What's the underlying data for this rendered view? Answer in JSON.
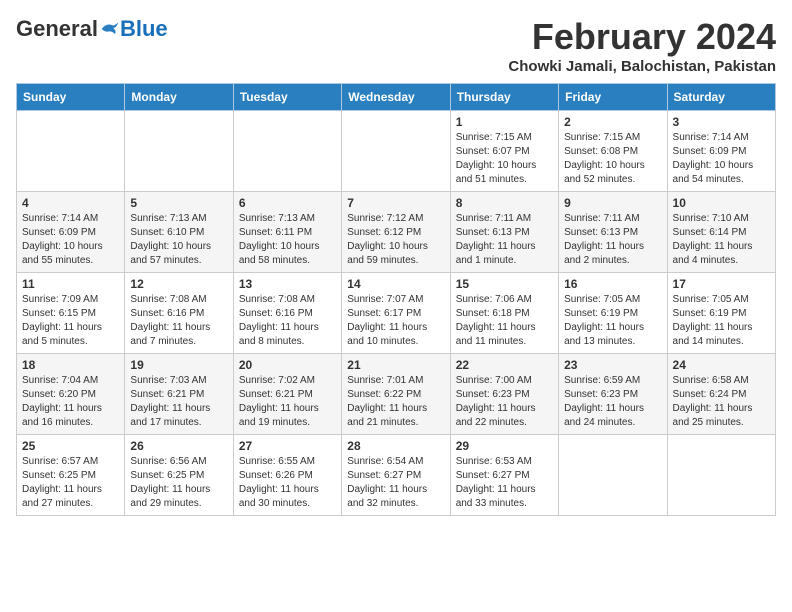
{
  "logo": {
    "general": "General",
    "blue": "Blue"
  },
  "title": "February 2024",
  "location": "Chowki Jamali, Balochistan, Pakistan",
  "days_of_week": [
    "Sunday",
    "Monday",
    "Tuesday",
    "Wednesday",
    "Thursday",
    "Friday",
    "Saturday"
  ],
  "weeks": [
    [
      {
        "day": "",
        "info": ""
      },
      {
        "day": "",
        "info": ""
      },
      {
        "day": "",
        "info": ""
      },
      {
        "day": "",
        "info": ""
      },
      {
        "day": "1",
        "info": "Sunrise: 7:15 AM\nSunset: 6:07 PM\nDaylight: 10 hours\nand 51 minutes."
      },
      {
        "day": "2",
        "info": "Sunrise: 7:15 AM\nSunset: 6:08 PM\nDaylight: 10 hours\nand 52 minutes."
      },
      {
        "day": "3",
        "info": "Sunrise: 7:14 AM\nSunset: 6:09 PM\nDaylight: 10 hours\nand 54 minutes."
      }
    ],
    [
      {
        "day": "4",
        "info": "Sunrise: 7:14 AM\nSunset: 6:09 PM\nDaylight: 10 hours\nand 55 minutes."
      },
      {
        "day": "5",
        "info": "Sunrise: 7:13 AM\nSunset: 6:10 PM\nDaylight: 10 hours\nand 57 minutes."
      },
      {
        "day": "6",
        "info": "Sunrise: 7:13 AM\nSunset: 6:11 PM\nDaylight: 10 hours\nand 58 minutes."
      },
      {
        "day": "7",
        "info": "Sunrise: 7:12 AM\nSunset: 6:12 PM\nDaylight: 10 hours\nand 59 minutes."
      },
      {
        "day": "8",
        "info": "Sunrise: 7:11 AM\nSunset: 6:13 PM\nDaylight: 11 hours\nand 1 minute."
      },
      {
        "day": "9",
        "info": "Sunrise: 7:11 AM\nSunset: 6:13 PM\nDaylight: 11 hours\nand 2 minutes."
      },
      {
        "day": "10",
        "info": "Sunrise: 7:10 AM\nSunset: 6:14 PM\nDaylight: 11 hours\nand 4 minutes."
      }
    ],
    [
      {
        "day": "11",
        "info": "Sunrise: 7:09 AM\nSunset: 6:15 PM\nDaylight: 11 hours\nand 5 minutes."
      },
      {
        "day": "12",
        "info": "Sunrise: 7:08 AM\nSunset: 6:16 PM\nDaylight: 11 hours\nand 7 minutes."
      },
      {
        "day": "13",
        "info": "Sunrise: 7:08 AM\nSunset: 6:16 PM\nDaylight: 11 hours\nand 8 minutes."
      },
      {
        "day": "14",
        "info": "Sunrise: 7:07 AM\nSunset: 6:17 PM\nDaylight: 11 hours\nand 10 minutes."
      },
      {
        "day": "15",
        "info": "Sunrise: 7:06 AM\nSunset: 6:18 PM\nDaylight: 11 hours\nand 11 minutes."
      },
      {
        "day": "16",
        "info": "Sunrise: 7:05 AM\nSunset: 6:19 PM\nDaylight: 11 hours\nand 13 minutes."
      },
      {
        "day": "17",
        "info": "Sunrise: 7:05 AM\nSunset: 6:19 PM\nDaylight: 11 hours\nand 14 minutes."
      }
    ],
    [
      {
        "day": "18",
        "info": "Sunrise: 7:04 AM\nSunset: 6:20 PM\nDaylight: 11 hours\nand 16 minutes."
      },
      {
        "day": "19",
        "info": "Sunrise: 7:03 AM\nSunset: 6:21 PM\nDaylight: 11 hours\nand 17 minutes."
      },
      {
        "day": "20",
        "info": "Sunrise: 7:02 AM\nSunset: 6:21 PM\nDaylight: 11 hours\nand 19 minutes."
      },
      {
        "day": "21",
        "info": "Sunrise: 7:01 AM\nSunset: 6:22 PM\nDaylight: 11 hours\nand 21 minutes."
      },
      {
        "day": "22",
        "info": "Sunrise: 7:00 AM\nSunset: 6:23 PM\nDaylight: 11 hours\nand 22 minutes."
      },
      {
        "day": "23",
        "info": "Sunrise: 6:59 AM\nSunset: 6:23 PM\nDaylight: 11 hours\nand 24 minutes."
      },
      {
        "day": "24",
        "info": "Sunrise: 6:58 AM\nSunset: 6:24 PM\nDaylight: 11 hours\nand 25 minutes."
      }
    ],
    [
      {
        "day": "25",
        "info": "Sunrise: 6:57 AM\nSunset: 6:25 PM\nDaylight: 11 hours\nand 27 minutes."
      },
      {
        "day": "26",
        "info": "Sunrise: 6:56 AM\nSunset: 6:25 PM\nDaylight: 11 hours\nand 29 minutes."
      },
      {
        "day": "27",
        "info": "Sunrise: 6:55 AM\nSunset: 6:26 PM\nDaylight: 11 hours\nand 30 minutes."
      },
      {
        "day": "28",
        "info": "Sunrise: 6:54 AM\nSunset: 6:27 PM\nDaylight: 11 hours\nand 32 minutes."
      },
      {
        "day": "29",
        "info": "Sunrise: 6:53 AM\nSunset: 6:27 PM\nDaylight: 11 hours\nand 33 minutes."
      },
      {
        "day": "",
        "info": ""
      },
      {
        "day": "",
        "info": ""
      }
    ]
  ]
}
